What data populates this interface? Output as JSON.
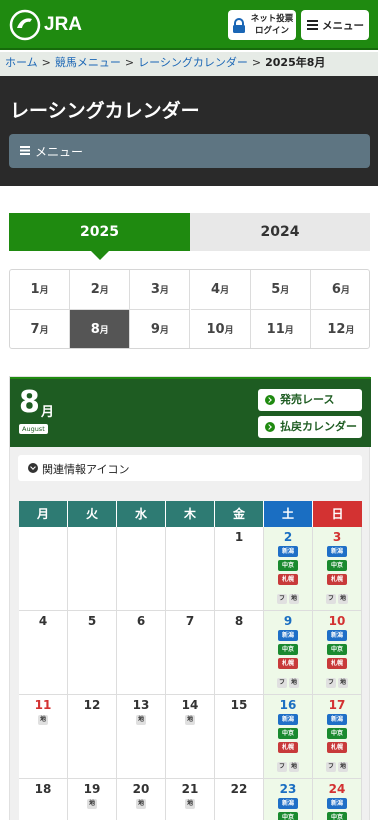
{
  "header": {
    "logo_text": "JRA",
    "login_line1": "ネット投票",
    "login_line2": "ログイン",
    "menu_label": "メニュー"
  },
  "breadcrumb": {
    "items": [
      "ホーム",
      "競馬メニュー",
      "レーシングカレンダー"
    ],
    "current": "2025年8月",
    "separator": ">"
  },
  "page": {
    "title": "レーシングカレンダー",
    "submenu_label": "メニュー"
  },
  "years": {
    "selected": "2025",
    "other": "2024"
  },
  "months": {
    "unit": "月",
    "items": [
      "1",
      "2",
      "3",
      "4",
      "5",
      "6",
      "7",
      "8",
      "9",
      "10",
      "11",
      "12"
    ],
    "selected": "8"
  },
  "calendar": {
    "month_number": "8",
    "month_unit": "月",
    "month_en": "August",
    "btn_races": "発売レース",
    "btn_payout": "払戻カレンダー",
    "icons_toggle": "関連情報アイコン",
    "weekdays": [
      "月",
      "火",
      "水",
      "木",
      "金",
      "土",
      "日"
    ],
    "venues": {
      "niigata": "新潟",
      "chukyo": "中京",
      "sapporo": "札幌"
    },
    "tag_f": "フ",
    "tag_chi": "地",
    "days": {
      "d1": "1",
      "d2": "2",
      "d3": "3",
      "d4": "4",
      "d5": "5",
      "d6": "6",
      "d7": "7",
      "d8": "8",
      "d9": "9",
      "d10": "10",
      "d11": "11",
      "d12": "12",
      "d13": "13",
      "d14": "14",
      "d15": "15",
      "d16": "16",
      "d17": "17",
      "d18": "18",
      "d19": "19",
      "d20": "20",
      "d21": "21",
      "d22": "22",
      "d23": "23",
      "d24": "24"
    }
  },
  "colors": {
    "brand_green": "#1f8a10",
    "dark_green": "#1e5c22",
    "saturday_blue": "#1a6ec2",
    "sunday_red": "#d33232"
  }
}
